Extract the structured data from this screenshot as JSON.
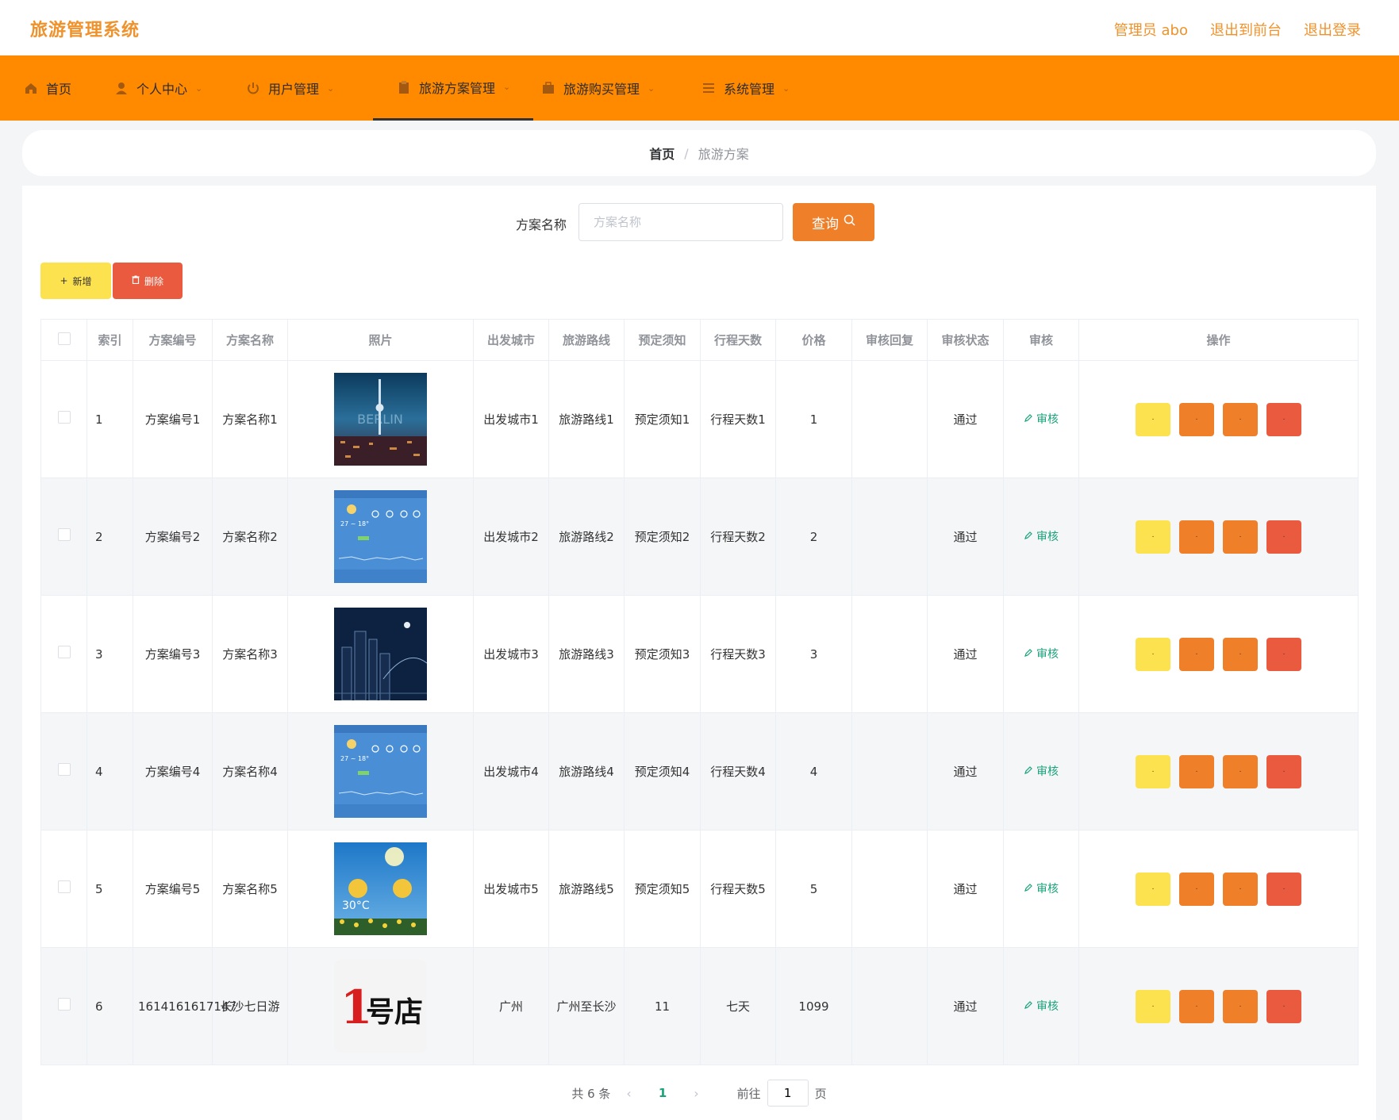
{
  "app": {
    "title": "旅游管理系统"
  },
  "header": {
    "links": [
      "管理员 abo",
      "退出到前台",
      "退出登录"
    ]
  },
  "nav": [
    {
      "label": "首页",
      "icon": "home-icon",
      "chevron": false
    },
    {
      "label": "个人中心",
      "icon": "user-icon",
      "chevron": true
    },
    {
      "label": "用户管理",
      "icon": "power-icon",
      "chevron": true
    },
    {
      "label": "旅游方案管理",
      "icon": "clipboard-icon",
      "chevron": true,
      "active": true
    },
    {
      "label": "旅游购买管理",
      "icon": "briefcase-icon",
      "chevron": true
    },
    {
      "label": "系统管理",
      "icon": "sliders-icon",
      "chevron": true
    }
  ],
  "breadcrumb": {
    "home": "首页",
    "current": "旅游方案"
  },
  "search": {
    "label": "方案名称",
    "placeholder": "方案名称",
    "button": "查询"
  },
  "actions": {
    "add": "新增",
    "delete": "删除"
  },
  "table": {
    "headers": [
      "索引",
      "方案编号",
      "方案名称",
      "照片",
      "出发城市",
      "旅游路线",
      "预定须知",
      "行程天数",
      "价格",
      "审核回复",
      "审核状态",
      "审核",
      "操作"
    ],
    "audit_label": "审核",
    "rows": [
      {
        "index": "1",
        "code": "方案编号1",
        "name": "方案名称1",
        "photo": "berlin-tower-night",
        "city": "出发城市1",
        "route": "旅游路线1",
        "notice": "预定须知1",
        "days": "行程天数1",
        "price": "1",
        "reply": "",
        "status": "通过"
      },
      {
        "index": "2",
        "code": "方案编号2",
        "name": "方案名称2",
        "photo": "weather-app-blue",
        "city": "出发城市2",
        "route": "旅游路线2",
        "notice": "预定须知2",
        "days": "行程天数2",
        "price": "2",
        "reply": "",
        "status": "通过"
      },
      {
        "index": "3",
        "code": "方案编号3",
        "name": "方案名称3",
        "photo": "city-skyline-night",
        "city": "出发城市3",
        "route": "旅游路线3",
        "notice": "预定须知3",
        "days": "行程天数3",
        "price": "3",
        "reply": "",
        "status": "通过"
      },
      {
        "index": "4",
        "code": "方案编号4",
        "name": "方案名称4",
        "photo": "weather-app-blue",
        "city": "出发城市4",
        "route": "旅游路线4",
        "notice": "预定须知4",
        "days": "行程天数4",
        "price": "4",
        "reply": "",
        "status": "通过"
      },
      {
        "index": "5",
        "code": "方案编号5",
        "name": "方案名称5",
        "photo": "weather-sunny-field",
        "city": "出发城市5",
        "route": "旅游路线5",
        "notice": "预定须知5",
        "days": "行程天数5",
        "price": "5",
        "reply": "",
        "status": "通过"
      },
      {
        "index": "6",
        "code": "1614161617147",
        "name": "长沙七日游",
        "photo": "yihaodian-logo",
        "city": "广州",
        "route": "广州至长沙",
        "notice": "11",
        "days": "七天",
        "price": "1099",
        "reply": "",
        "status": "通过"
      }
    ]
  },
  "pagination": {
    "total": "共 6 条",
    "current": "1",
    "goto_prefix": "前往",
    "goto_value": "1",
    "goto_suffix": "页"
  },
  "colors": {
    "brand": "#f0922b",
    "nav": "#ff8a00",
    "add": "#fde24f",
    "op_orange": "#f07f2a",
    "delete": "#ea5a3f",
    "audit": "#1aa37a"
  }
}
